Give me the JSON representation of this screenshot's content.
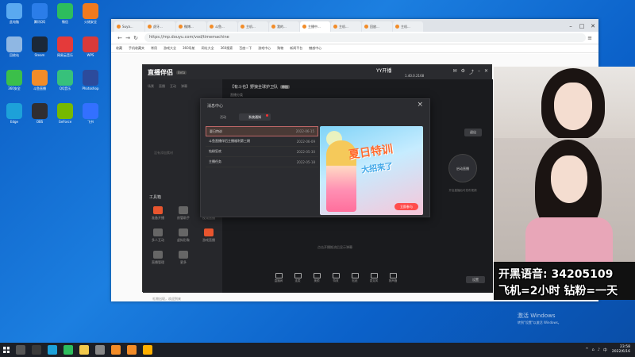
{
  "browser": {
    "tabs": [
      {
        "label": "Suya...",
        "active": false
      },
      {
        "label": "虎牙...",
        "active": false
      },
      {
        "label": "微博...",
        "active": false
      },
      {
        "label": "斗鱼...",
        "active": false
      },
      {
        "label": "主机...",
        "active": false
      },
      {
        "label": "我的...",
        "active": false
      },
      {
        "label": "主播中...",
        "active": true
      },
      {
        "label": "主机...",
        "active": false
      },
      {
        "label": "回放...",
        "active": false
      },
      {
        "label": "主机...",
        "active": false
      }
    ],
    "url": "https://mp.douyu.com/vod/timemachine",
    "bookmarks": [
      "收藏",
      "手机收藏夹",
      "常用",
      "游戏大全",
      "360导航",
      "网址大全",
      "360搜索",
      "百度一下",
      "游戏中心",
      "购物",
      "新闻平台",
      "魅惑中心"
    ]
  },
  "app": {
    "logo": "直播伴侣",
    "badge": "Beta",
    "user": "YY开播",
    "version": "1.40.0.2168",
    "left_tabs": [
      "场景",
      "直播",
      "互动",
      "弹幕"
    ],
    "scene_hint": "没有添加素材",
    "tools_title": "工具箱",
    "tools": [
      {
        "label": "准备开播"
      },
      {
        "label": "房管助手"
      },
      {
        "label": "视频直播"
      },
      {
        "label": "多人互动"
      },
      {
        "label": "虚拟形象"
      },
      {
        "label": "游戏直播"
      },
      {
        "label": "直播管理"
      },
      {
        "label": "更多"
      }
    ],
    "bottom_note": "礼物出现，欢迎到来",
    "room_title": "【有斗也】野狼全球护卫队",
    "room_tag": "审核",
    "room_sub": "直播分类",
    "exit_label": "退出",
    "start_label": "启动直播",
    "start_hint": "开启直播后可发布视频",
    "push_hint": "点击开播推流后显示弹幕",
    "bottom_tools": [
      "直播间",
      "连麦",
      "美颜",
      "特效",
      "贴纸",
      "麦克风",
      "扬声器"
    ],
    "settings_label": "设置"
  },
  "modal": {
    "title": "消息中心",
    "tabs": [
      {
        "label": "活动",
        "active": false
      },
      {
        "label": "系统通知",
        "active": true
      }
    ],
    "messages": [
      {
        "title": "夏日特训",
        "date": "2022-06-15",
        "selected": true
      },
      {
        "title": "斗鱼直播伴侣主播福利第三期",
        "date": "2022-06-09",
        "selected": false
      },
      {
        "title": "钻粉狂欢",
        "date": "2022-05-30",
        "selected": false
      },
      {
        "title": "主播任务",
        "date": "2022-05-18",
        "selected": false
      }
    ],
    "promo_title": "夏日特训",
    "promo_sub": "大招来了",
    "promo_cta": "立即参与"
  },
  "overlay": {
    "line1": "开黑语音: 34205109",
    "line2": "飞机=2小时 钻粉=一天"
  },
  "activation": {
    "line1": "激活 Windows",
    "line2": "转到\"设置\"以激活 Windows。"
  },
  "taskbar": {
    "time": "23:58",
    "date": "2022/6/16",
    "ime": "中"
  },
  "desktop": {
    "icons": [
      {
        "label": "此电脑",
        "color": "#5aa9f0"
      },
      {
        "label": "腾讯QQ",
        "color": "#2b7de9"
      },
      {
        "label": "微信",
        "color": "#2dbd5d"
      },
      {
        "label": "火绒安全",
        "color": "#f07a1e"
      },
      {
        "label": "回收站",
        "color": "#8fb7e3"
      },
      {
        "label": "Steam",
        "color": "#1b2838"
      },
      {
        "label": "网易云音乐",
        "color": "#e43a3a"
      },
      {
        "label": "WPS",
        "color": "#d93a3a"
      },
      {
        "label": "360安全",
        "color": "#3bbf4a"
      },
      {
        "label": "斗鱼直播",
        "color": "#f28c28"
      },
      {
        "label": "QQ音乐",
        "color": "#37c17b"
      },
      {
        "label": "Photoshop",
        "color": "#2c4b9c"
      },
      {
        "label": "Edge",
        "color": "#1da1d9"
      },
      {
        "label": "OBS",
        "color": "#302e31"
      },
      {
        "label": "GeForce",
        "color": "#76b900"
      },
      {
        "label": "飞书",
        "color": "#3370ff"
      }
    ]
  }
}
